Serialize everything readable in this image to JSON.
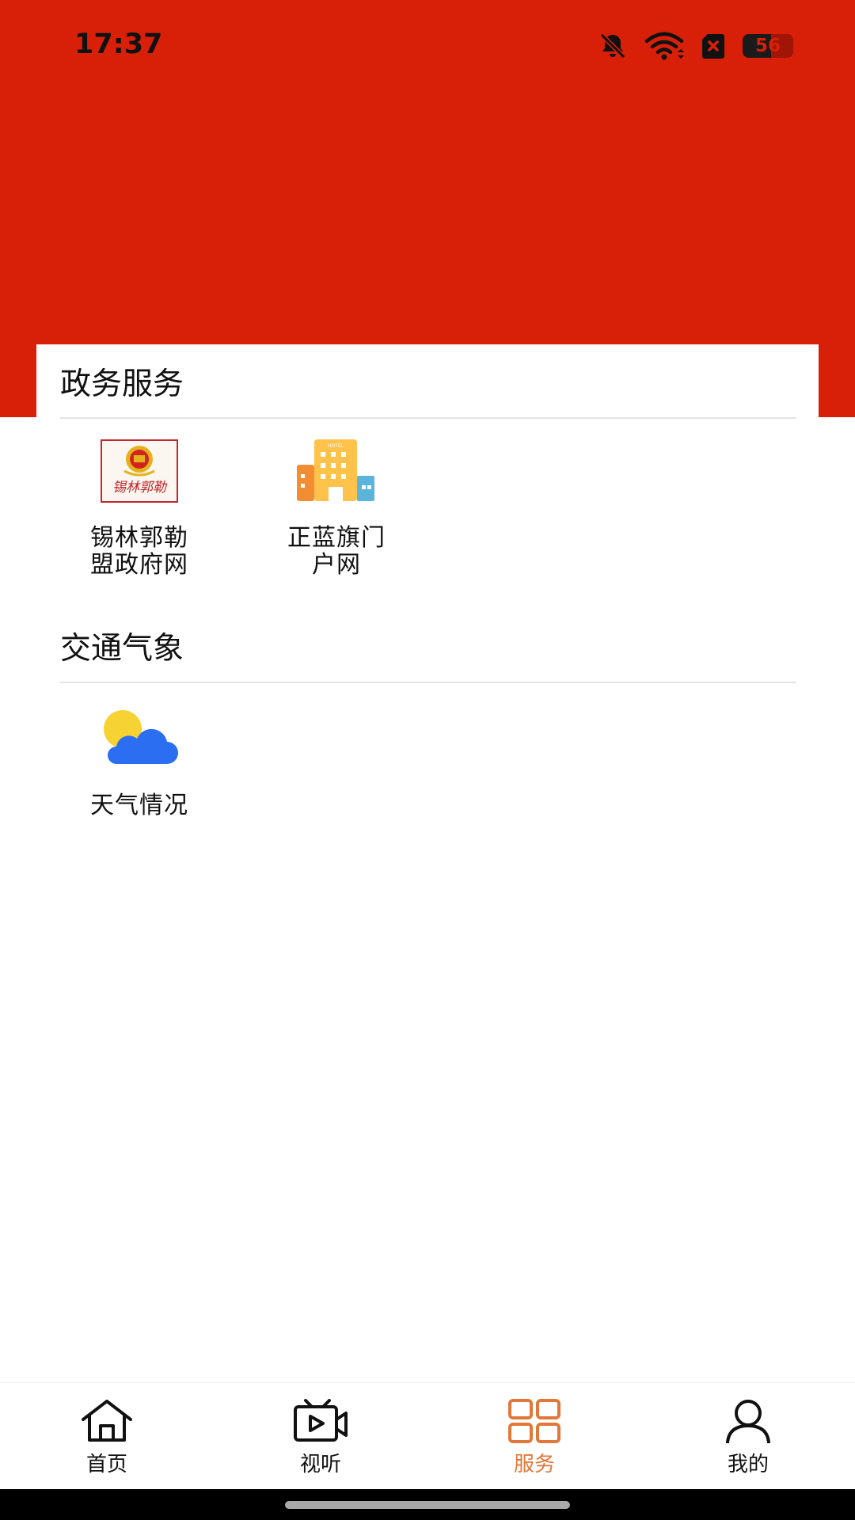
{
  "status_bar": {
    "time": "17:37",
    "battery": "56",
    "icons": [
      "bell-off-icon",
      "wifi-icon",
      "sim-x-icon",
      "battery-icon"
    ]
  },
  "sections": [
    {
      "title": "政务服务",
      "items": [
        {
          "label_line1": "锡林郭勒",
          "label_line2": "盟政府网",
          "icon": "xilingol-gov-icon",
          "icon_text": "锡林郭勒"
        },
        {
          "label_line1": "正蓝旗门",
          "label_line2": "户网",
          "icon": "hotel-building-icon",
          "icon_text": "HOTEL"
        }
      ]
    },
    {
      "title": "交通气象",
      "items": [
        {
          "label_line1": "天气情况",
          "label_line2": "",
          "icon": "weather-cloud-sun-icon"
        }
      ]
    }
  ],
  "bottom_nav": {
    "items": [
      {
        "label": "首页",
        "icon": "home-icon"
      },
      {
        "label": "视听",
        "icon": "tv-play-icon"
      },
      {
        "label": "服务",
        "icon": "grid-icon"
      },
      {
        "label": "我的",
        "icon": "user-icon"
      }
    ],
    "active_index": 2,
    "active_color": "#e1783a"
  },
  "colors": {
    "header_red": "#d82008",
    "accent": "#e1783a"
  }
}
